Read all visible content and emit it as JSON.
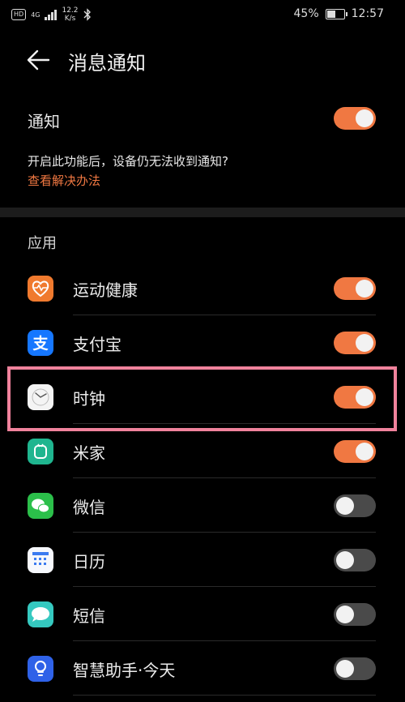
{
  "status": {
    "hd": "HD",
    "network": "4G",
    "speed_value": "12.2",
    "speed_unit": "K/s",
    "battery": "45%",
    "time": "12:57"
  },
  "header": {
    "title": "消息通知"
  },
  "notifications": {
    "label": "通知",
    "enabled": true,
    "description": "开启此功能后，设备仍无法收到通知?",
    "link": "查看解决办法"
  },
  "apps_section": {
    "title": "应用",
    "items": [
      {
        "name": "运动健康",
        "enabled": true,
        "icon": "health-icon"
      },
      {
        "name": "支付宝",
        "enabled": true,
        "icon": "alipay-icon"
      },
      {
        "name": "时钟",
        "enabled": true,
        "icon": "clock-icon"
      },
      {
        "name": "米家",
        "enabled": true,
        "icon": "mijia-icon"
      },
      {
        "name": "微信",
        "enabled": false,
        "icon": "wechat-icon"
      },
      {
        "name": "日历",
        "enabled": false,
        "icon": "calendar-icon"
      },
      {
        "name": "短信",
        "enabled": false,
        "icon": "messages-icon"
      },
      {
        "name": "智慧助手·今天",
        "enabled": false,
        "icon": "assistant-icon"
      }
    ]
  },
  "colors": {
    "accent": "#f07842",
    "highlight": "#f0829c",
    "toggle_off": "#4a4a4a"
  }
}
